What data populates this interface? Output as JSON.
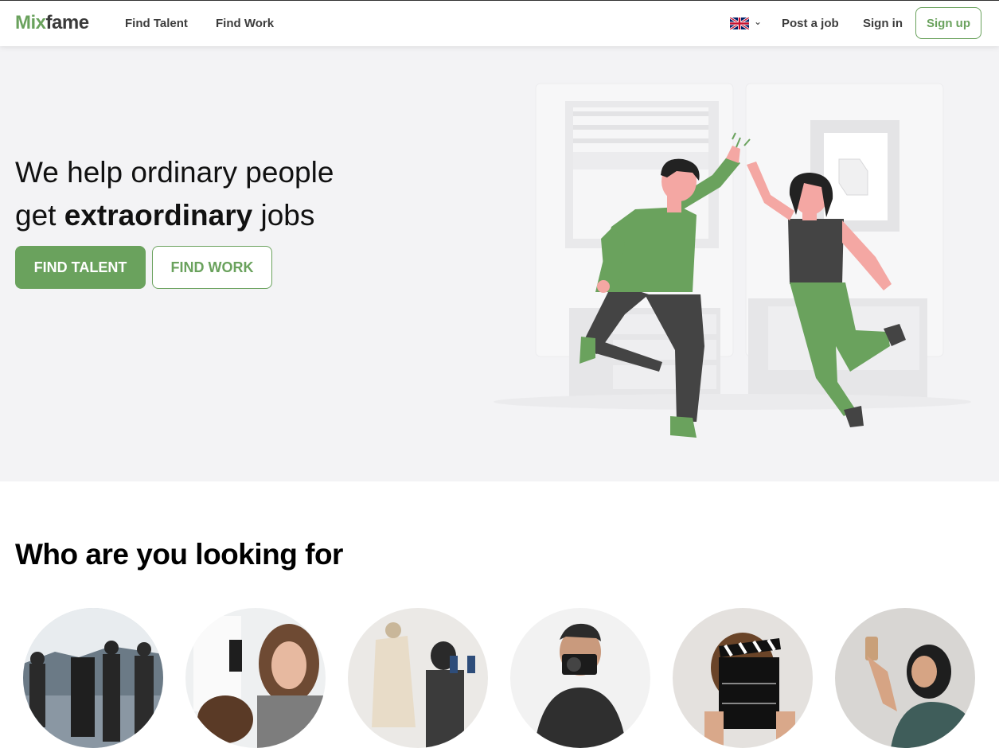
{
  "header": {
    "logo_part1": "Mix",
    "logo_part2": "fame",
    "nav": [
      "Find Talent",
      "Find Work"
    ],
    "language_icon": "uk-flag-icon",
    "post_job": "Post a job",
    "sign_in": "Sign in",
    "sign_up": "Sign up"
  },
  "hero": {
    "line1": "We help ordinary people",
    "line2_pre": "get ",
    "line2_bold": "extraordinary",
    "line2_post": " jobs",
    "primary_button": "FIND TALENT",
    "secondary_button": "FIND WORK"
  },
  "section": {
    "title": "Who are you looking for"
  },
  "colors": {
    "brand_green": "#6aa25d",
    "hero_bg": "#f3f3f5",
    "text_dark": "#111111"
  }
}
